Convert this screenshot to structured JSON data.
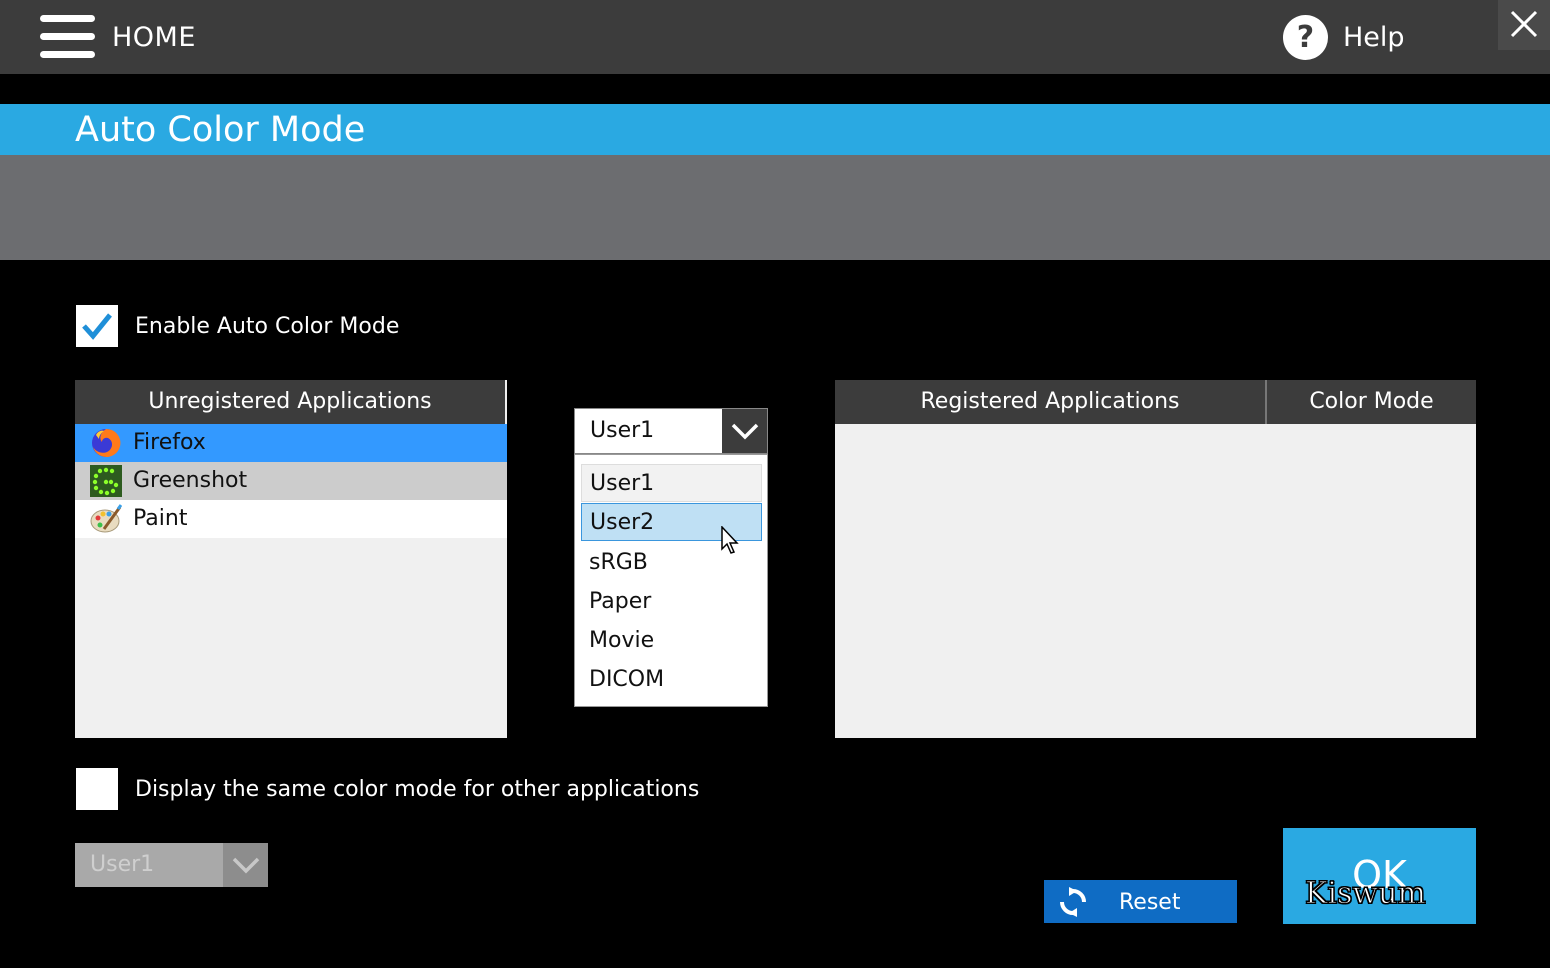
{
  "topbar": {
    "home_label": "HOME",
    "help_label": "Help",
    "help_glyph": "?"
  },
  "title": "Auto Color Mode",
  "enable_auto": {
    "label": "Enable Auto Color Mode",
    "checked": true
  },
  "unregistered": {
    "header": "Unregistered Applications",
    "apps": [
      {
        "name": "Firefox",
        "icon": "firefox-icon",
        "state": "selected"
      },
      {
        "name": "Greenshot",
        "icon": "greenshot-icon",
        "state": "highlighted"
      },
      {
        "name": "Paint",
        "icon": "paint-icon",
        "state": "normal"
      }
    ]
  },
  "mode_dropdown": {
    "value": "User1",
    "options": [
      "User1",
      "User2",
      "sRGB",
      "Paper",
      "Movie",
      "DICOM"
    ],
    "selected_option": "User1",
    "hovered_option": "User2"
  },
  "registered": {
    "header_app": "Registered Applications",
    "header_mode": "Color Mode",
    "rows": []
  },
  "same_mode": {
    "label": "Display the same color mode for other applications",
    "checked": false
  },
  "other_dropdown": {
    "value": "User1",
    "disabled": true
  },
  "buttons": {
    "reset": "Reset",
    "ok": "OK"
  },
  "watermark": "Kiswum",
  "colors": {
    "accent": "#2aa9e2",
    "topbar": "#3c3c3c",
    "selection": "#3399ff",
    "reset": "#0f6cc4"
  }
}
